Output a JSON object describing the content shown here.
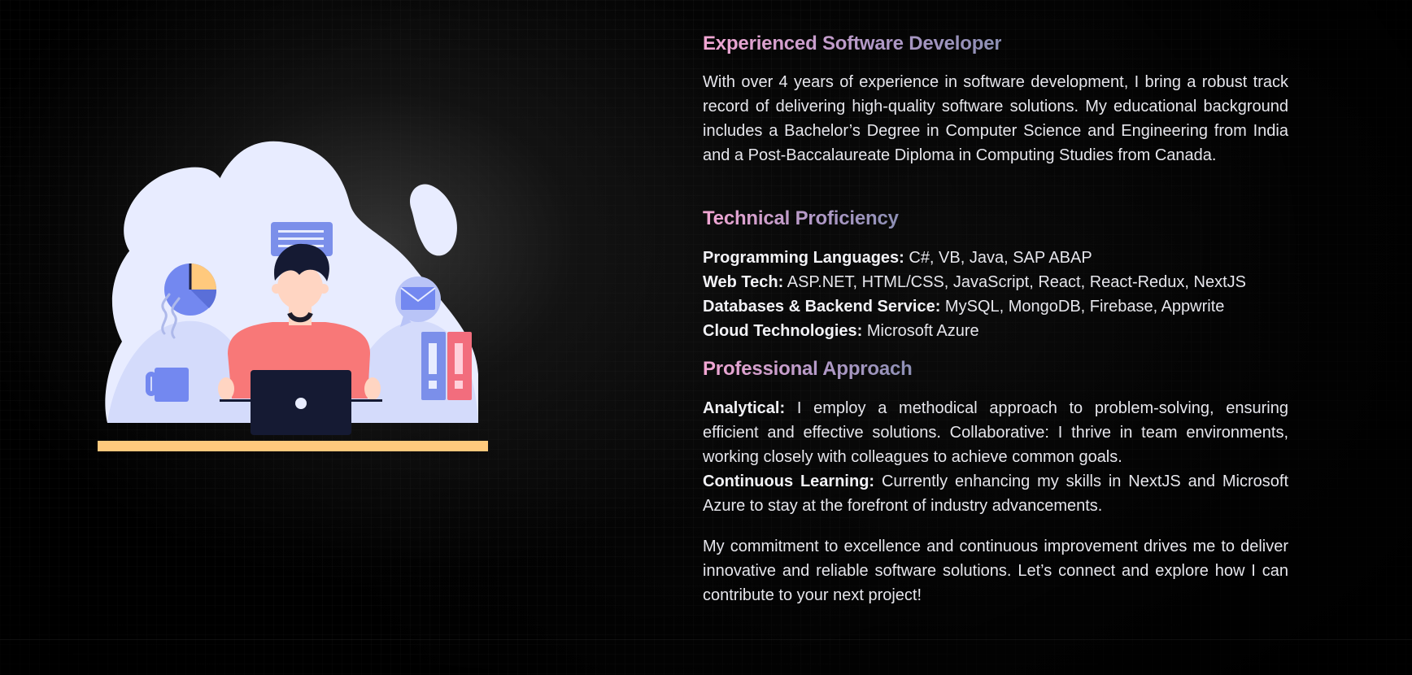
{
  "sections": {
    "experience": {
      "title": "Experienced Software Developer",
      "body": "With over 4 years of experience in software development, I bring a robust track record of delivering high-quality software solutions. My educational background includes a Bachelor’s Degree in Computer Science and Engineering from India and a Post-Baccalaureate Diploma in Computing Studies from Canada."
    },
    "technical": {
      "title": "Technical Proficiency",
      "items": [
        {
          "label": "Programming Languages:",
          "value": " C#, VB, Java, SAP ABAP"
        },
        {
          "label": "Web Tech:",
          "value": " ASP.NET, HTML/CSS, JavaScript, React, React-Redux, NextJS"
        },
        {
          "label": "Databases & Backend Service:",
          "value": " MySQL, MongoDB, Firebase, Appwrite"
        },
        {
          "label": "Cloud Technologies:",
          "value": " Microsoft Azure"
        }
      ]
    },
    "approach": {
      "title": "Professional Approach",
      "analytical_label": "Analytical:",
      "analytical_text": " I employ a methodical approach to problem-solving, ensuring efficient and effective solutions. Collaborative: I thrive in team environments, working closely with colleagues to achieve common goals.",
      "learning_label": "Continuous Learning:",
      "learning_text": " Currently enhancing my skills in NextJS and Microsoft Azure to stay at the forefront of industry advancements."
    },
    "commitment": {
      "body": "My commitment to excellence and continuous improvement drives me to deliver innovative and reliable software solutions. Let’s connect and explore how I can contribute to your next project!"
    }
  },
  "illustration": {
    "icons": [
      "chat-bubble-icon",
      "pie-chart-icon",
      "mail-icon",
      "coffee-mug-icon",
      "books-icon",
      "laptop-icon"
    ]
  },
  "colors": {
    "background": "#000000",
    "heading_gradient_start": "#f3a6d3",
    "heading_gradient_end": "#8c8fb4",
    "body_text": "#e6e6ec",
    "blob": "#e8ecff",
    "accent_blue": "#7388f0",
    "shirt": "#f87878",
    "desk": "#ffc97d"
  }
}
